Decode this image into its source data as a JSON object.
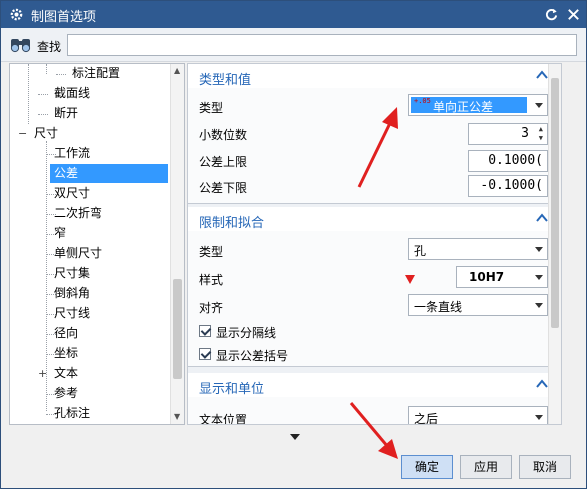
{
  "window": {
    "title": "制图首选项"
  },
  "search": {
    "label": "查找",
    "value": ""
  },
  "tree": {
    "items": [
      {
        "label": "标注配置"
      },
      {
        "label": "截面线"
      },
      {
        "label": "断开"
      },
      {
        "label": "尺寸"
      },
      {
        "label": "工作流"
      },
      {
        "label": "公差"
      },
      {
        "label": "双尺寸"
      },
      {
        "label": "二次折弯"
      },
      {
        "label": "窄"
      },
      {
        "label": "单侧尺寸"
      },
      {
        "label": "尺寸集"
      },
      {
        "label": "倒斜角"
      },
      {
        "label": "尺寸线"
      },
      {
        "label": "径向"
      },
      {
        "label": "坐标"
      },
      {
        "label": "文本"
      },
      {
        "label": "参考"
      },
      {
        "label": "孔标注"
      }
    ],
    "expanders": {
      "dimension": "−",
      "text": "+"
    }
  },
  "sections": {
    "type_value": {
      "title": "类型和值",
      "type_label": "类型",
      "type_value": "单向正公差",
      "type_icon_text": "+.05",
      "decimals_label": "小数位数",
      "decimals_value": "3",
      "upper_label": "公差上限",
      "upper_value": "0.1000(",
      "lower_label": "公差下限",
      "lower_value": "-0.1000("
    },
    "limits_fits": {
      "title": "限制和拟合",
      "type_label": "类型",
      "type_value": "孔",
      "style_label": "样式",
      "style_value": "10H7",
      "align_label": "对齐",
      "align_value": "一条直线",
      "show_separator_label": "显示分隔线",
      "show_separator_checked": true,
      "show_brackets_label": "显示公差括号",
      "show_brackets_checked": true
    },
    "display_units": {
      "title": "显示和单位",
      "text_position_label": "文本位置",
      "text_position_value": "之后"
    }
  },
  "buttons": {
    "ok": "确定",
    "apply": "应用",
    "cancel": "取消"
  },
  "colors": {
    "titlebar": "#2f5a91",
    "selection": "#3399ff",
    "section_title": "#2667b7",
    "annotation_arrow": "#e02020"
  }
}
